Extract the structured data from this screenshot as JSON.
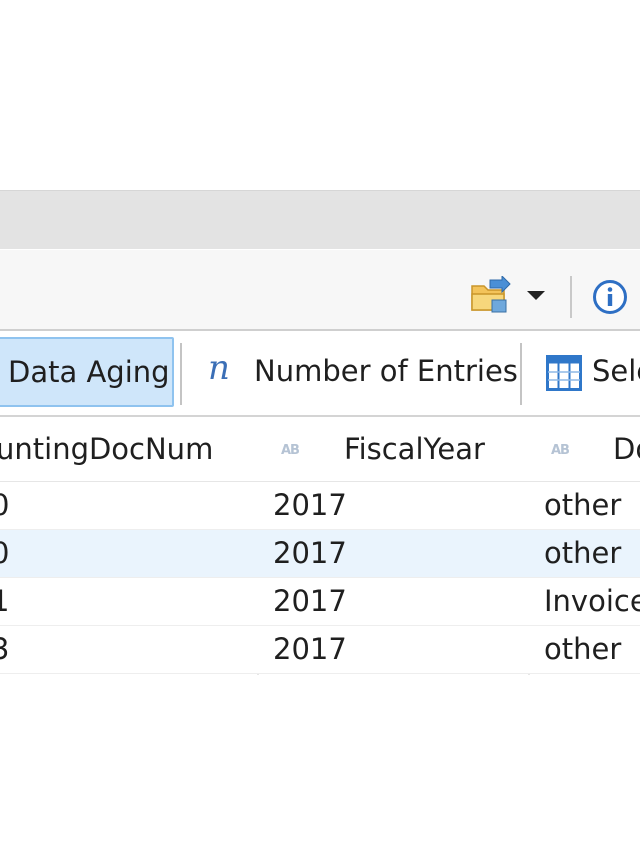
{
  "toolbar": {
    "folder_icon": "folder-export-icon",
    "dropdown_icon": "chevron-down-icon",
    "info_icon": "info-icon"
  },
  "features": {
    "data_aging_label": "Data Aging",
    "number_of_entries_label": "Number of Entries",
    "select_label": "Sele",
    "number_icon": "𝑛"
  },
  "table": {
    "type_icon_text": "AB",
    "columns": [
      "untingDocNum",
      "FiscalYear",
      "Do"
    ],
    "rows": [
      [
        "0",
        "2017",
        "other"
      ],
      [
        "0",
        "2017",
        "other"
      ],
      [
        "1",
        "2017",
        "Invoice"
      ],
      [
        "3",
        "2017",
        "other"
      ]
    ]
  },
  "colors": {
    "selected_button_bg": "#cfe6fa",
    "selected_button_border": "#8fc3ef",
    "alt_row_bg": "#eaf4fd",
    "icon_blue": "#3b6fb6"
  }
}
